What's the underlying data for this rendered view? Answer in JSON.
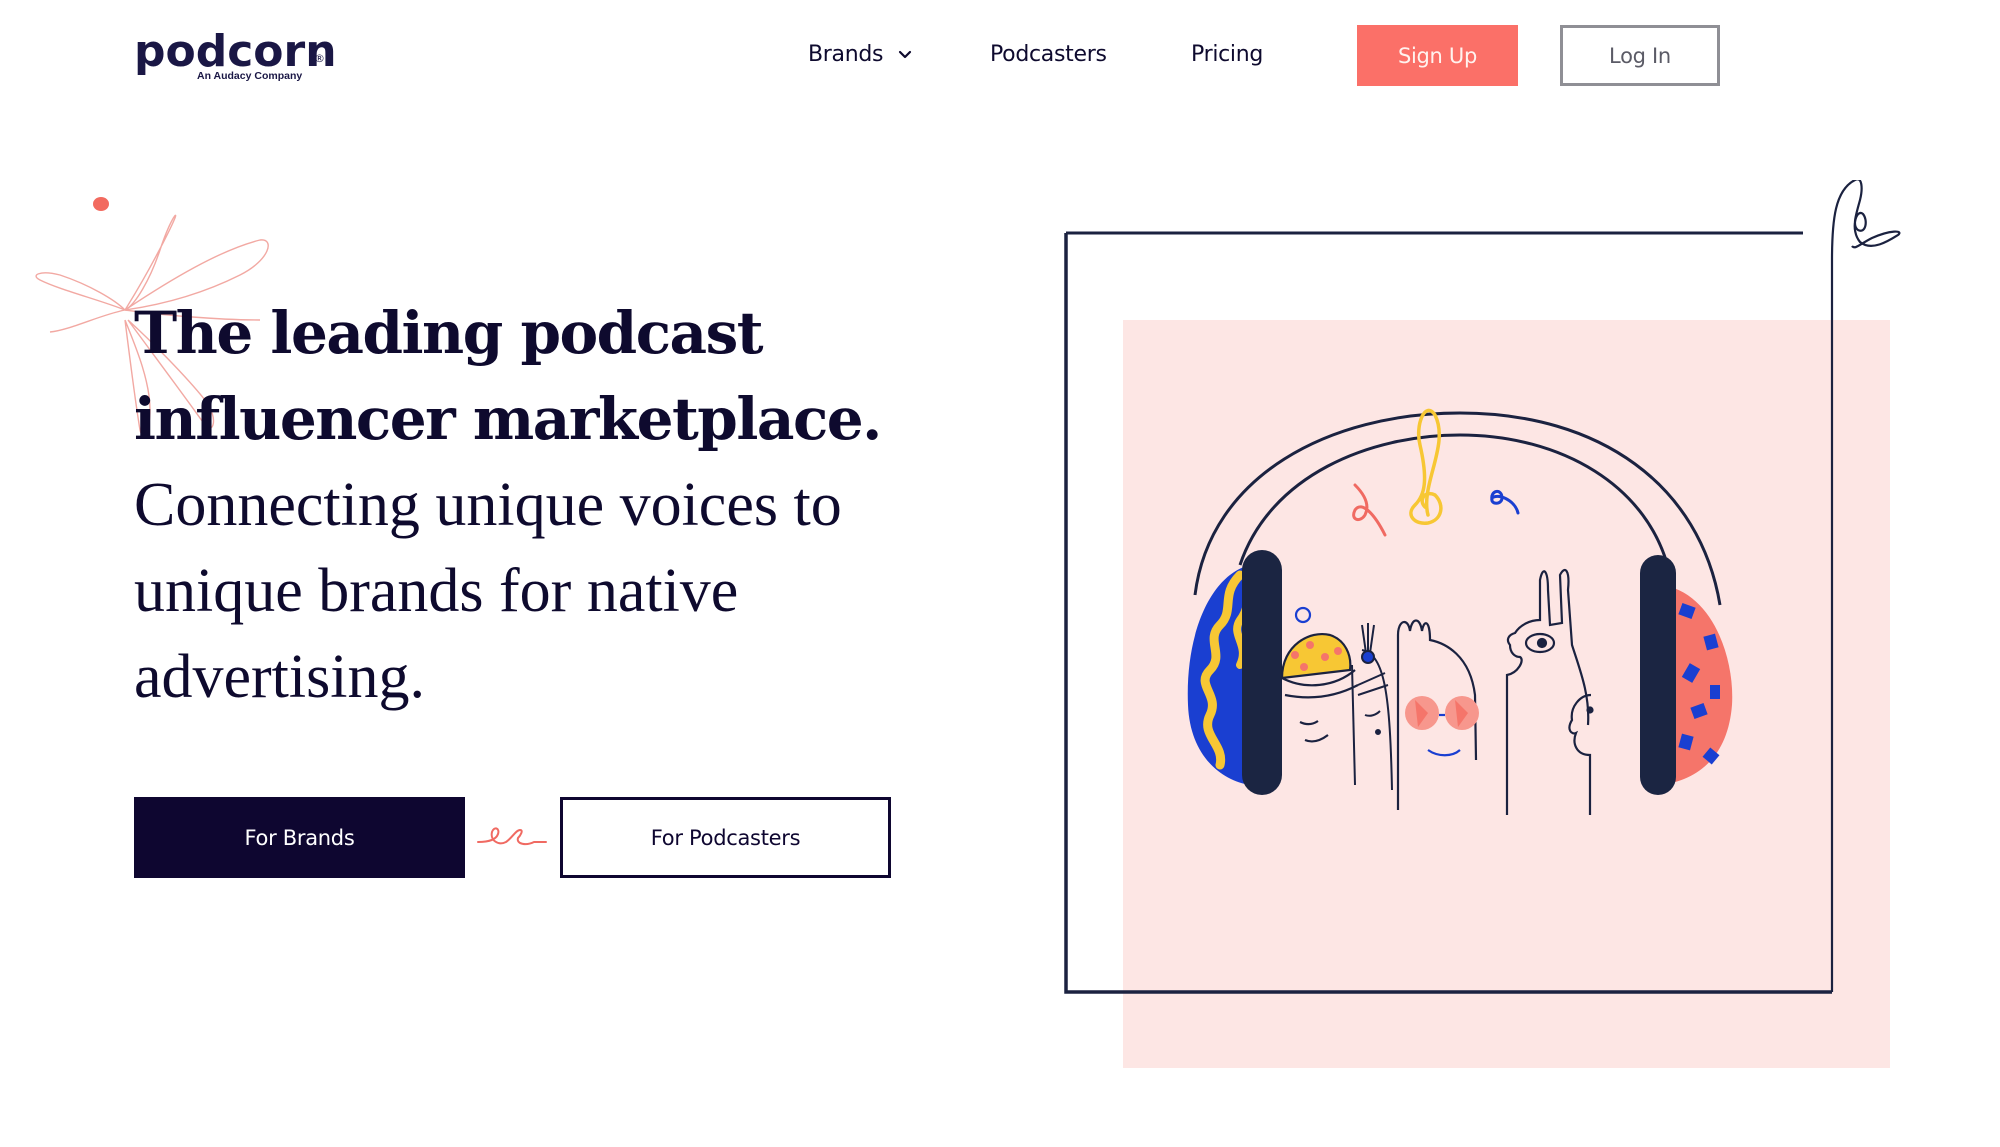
{
  "header": {
    "logo": {
      "wordmark": "podcorn",
      "registered": "®",
      "tagline": "An Audacy Company"
    },
    "nav": [
      {
        "label": "Brands",
        "icon": "chevron-down-icon",
        "has_dropdown": true
      },
      {
        "label": "Podcasters"
      },
      {
        "label": "Pricing"
      }
    ],
    "signup_label": "Sign Up",
    "login_label": "Log In"
  },
  "hero": {
    "title_line1": "The leading podcast",
    "title_line2": "influencer marketplace.",
    "subtitle_line1": "Connecting unique voices to",
    "subtitle_line2": "unique brands for native",
    "subtitle_line3": "advertising.",
    "cta_brands": "For Brands",
    "cta_podcasters": "For Podcasters"
  },
  "illustration": {
    "description": "characters-wearing-headphones-icon",
    "icons": [
      "headphones-icon",
      "treble-clef-icon",
      "music-note-icon"
    ]
  },
  "colors": {
    "brand_navy": "#0e0630",
    "accent_coral": "#fb7068",
    "pink_bg": "#fde6e4",
    "accent_blue": "#1a3fd1",
    "accent_yellow": "#f7c734"
  }
}
